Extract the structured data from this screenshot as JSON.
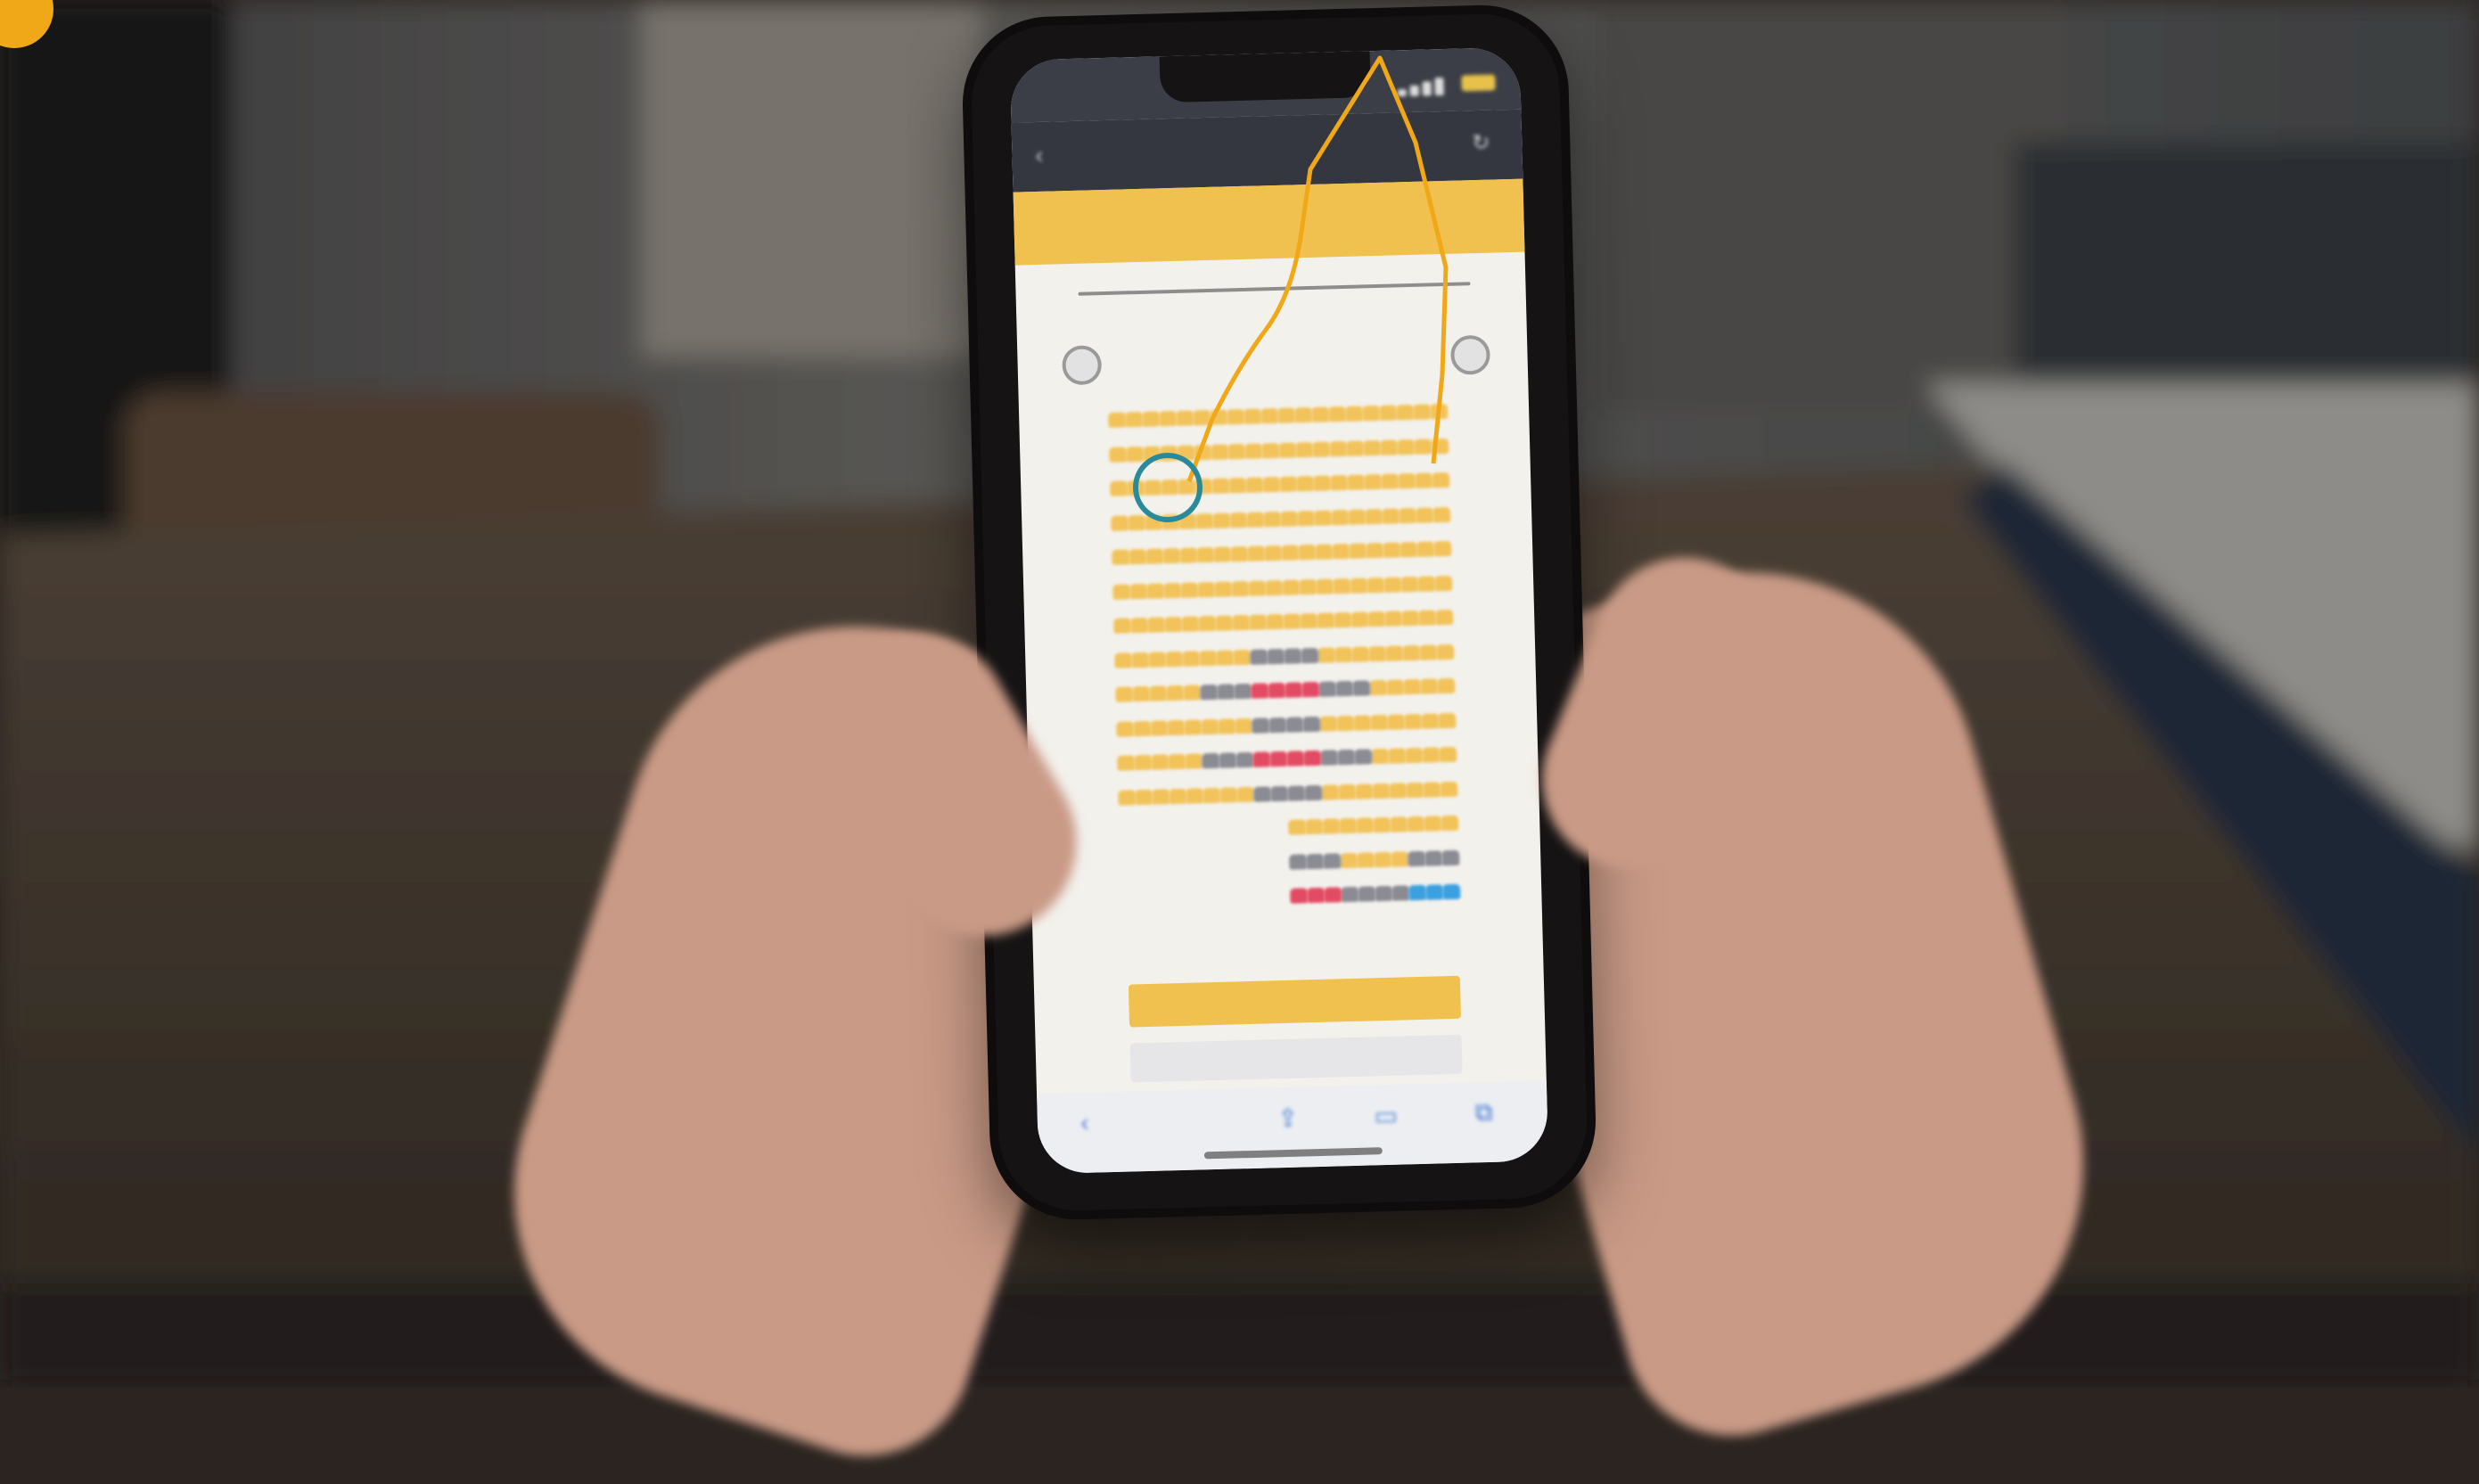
{
  "photo": {
    "description_colors": {
      "accent_yellow": "#f0c14e",
      "seat_taken": "#8b8b93",
      "seat_selected": "#e24b64",
      "seat_wheelchair": "#3ba0e0",
      "annotation_orange": "#f0a818",
      "annotation_teal": "#2a8a9a"
    }
  },
  "phone_screen": {
    "status_time": "",
    "browser_url": "",
    "site_logo": "",
    "screen_caption": "",
    "continue_button": "",
    "secondary_button": "",
    "icons": [
      "back-icon",
      "refresh-icon",
      "share-icon",
      "bookmarks-icon",
      "tabs-icon"
    ]
  },
  "seat_map": {
    "rows": [
      {
        "free": [
          [
            0,
            20
          ]
        ],
        "taken": [],
        "selected": [],
        "wheel": []
      },
      {
        "free": [
          [
            0,
            20
          ]
        ],
        "taken": [],
        "selected": [],
        "wheel": []
      },
      {
        "free": [
          [
            0,
            20
          ]
        ],
        "taken": [],
        "selected": [],
        "wheel": []
      },
      {
        "free": [
          [
            0,
            20
          ]
        ],
        "taken": [],
        "selected": [],
        "wheel": []
      },
      {
        "free": [
          [
            0,
            20
          ]
        ],
        "taken": [],
        "selected": [],
        "wheel": []
      },
      {
        "free": [
          [
            0,
            20
          ]
        ],
        "taken": [],
        "selected": [],
        "wheel": []
      },
      {
        "free": [
          [
            0,
            20
          ]
        ],
        "taken": [],
        "selected": [],
        "wheel": []
      },
      {
        "free": [
          [
            0,
            8
          ],
          [
            12,
            20
          ]
        ],
        "taken": [
          [
            8,
            12
          ]
        ],
        "selected": [],
        "wheel": []
      },
      {
        "free": [
          [
            0,
            5
          ],
          [
            15,
            20
          ]
        ],
        "taken": [
          [
            5,
            8
          ],
          [
            12,
            15
          ]
        ],
        "selected": [
          [
            8,
            12
          ]
        ],
        "wheel": []
      },
      {
        "free": [
          [
            0,
            8
          ],
          [
            12,
            20
          ]
        ],
        "taken": [
          [
            8,
            12
          ]
        ],
        "selected": [],
        "wheel": []
      },
      {
        "free": [
          [
            0,
            5
          ],
          [
            15,
            20
          ]
        ],
        "taken": [
          [
            5,
            8
          ],
          [
            12,
            15
          ]
        ],
        "selected": [
          [
            8,
            12
          ]
        ],
        "wheel": []
      },
      {
        "free": [
          [
            0,
            8
          ],
          [
            12,
            20
          ]
        ],
        "taken": [
          [
            8,
            12
          ]
        ],
        "selected": [],
        "wheel": []
      },
      {
        "free": [
          [
            10,
            20
          ]
        ],
        "taken": [],
        "selected": [],
        "wheel": []
      },
      {
        "free": [
          [
            13,
            17
          ]
        ],
        "taken": [
          [
            10,
            13
          ],
          [
            17,
            20
          ]
        ],
        "selected": [],
        "wheel": []
      },
      {
        "free": [],
        "taken": [
          [
            13,
            17
          ]
        ],
        "selected": [
          [
            10,
            13
          ]
        ],
        "wheel": [
          [
            17,
            20
          ]
        ]
      }
    ],
    "highlighted_seat": {
      "row": 2,
      "seat": 2
    }
  }
}
